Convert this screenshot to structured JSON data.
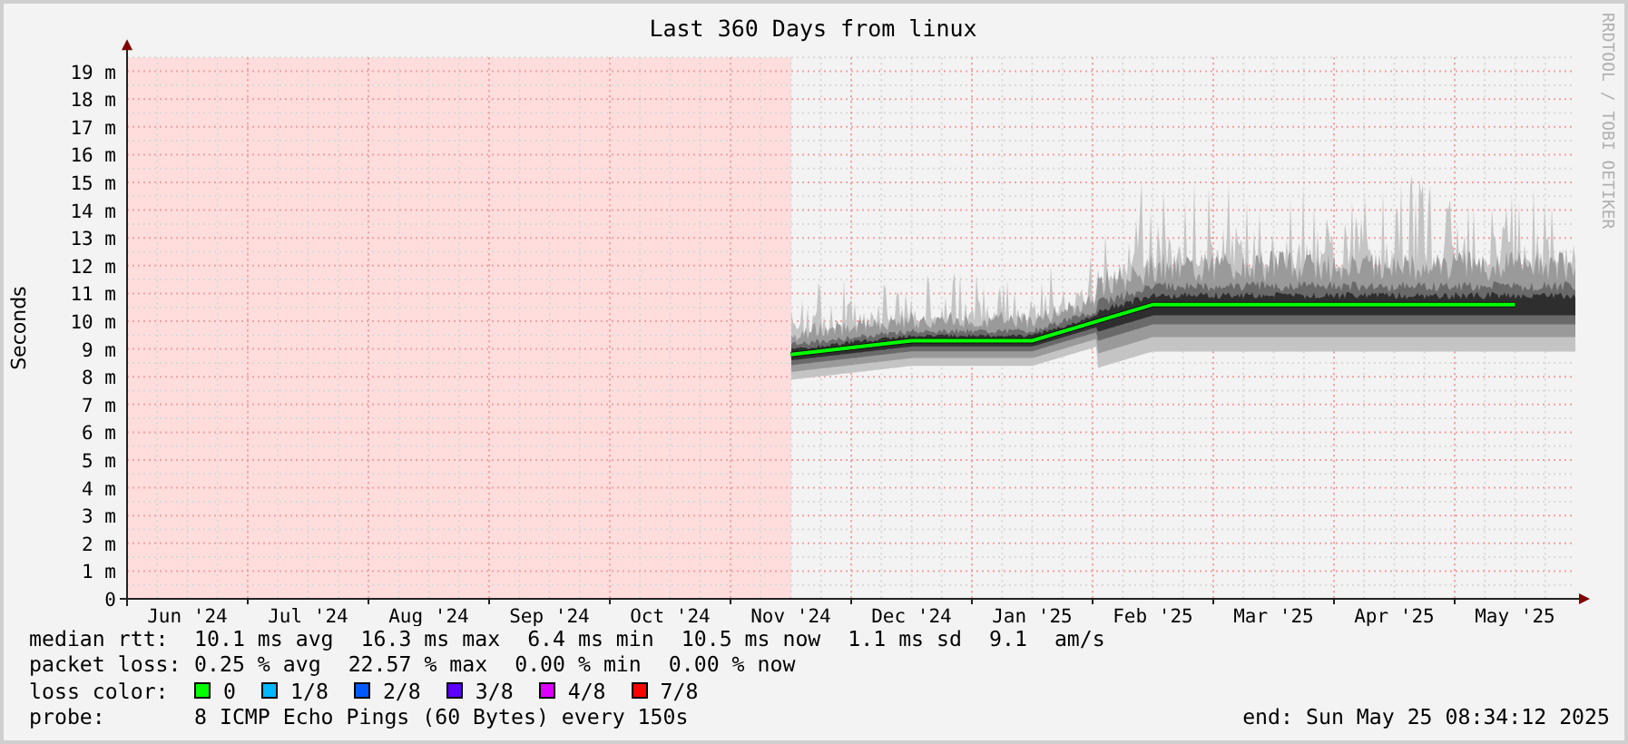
{
  "title": "Last 360 Days from linux",
  "credit": "RRDTOOL / TOBI OETIKER",
  "chart_data": {
    "type": "line",
    "grid": true,
    "ylabel": "Seconds",
    "ylim": [
      0,
      19.5
    ],
    "categories": [
      "Jun '24",
      "Jul '24",
      "Aug '24",
      "Sep '24",
      "Oct '24",
      "Nov '24",
      "Dec '24",
      "Jan '25",
      "Feb '25",
      "Mar '25",
      "Apr '25",
      "May '25"
    ],
    "yticks": [
      {
        "value": 0,
        "label": "0"
      },
      {
        "value": 1,
        "label": "1 m"
      },
      {
        "value": 2,
        "label": "2 m"
      },
      {
        "value": 3,
        "label": "3 m"
      },
      {
        "value": 4,
        "label": "4 m"
      },
      {
        "value": 5,
        "label": "5 m"
      },
      {
        "value": 6,
        "label": "6 m"
      },
      {
        "value": 7,
        "label": "7 m"
      },
      {
        "value": 8,
        "label": "8 m"
      },
      {
        "value": 9,
        "label": "9 m"
      },
      {
        "value": 10,
        "label": "10 m"
      },
      {
        "value": 11,
        "label": "11 m"
      },
      {
        "value": 12,
        "label": "12 m"
      },
      {
        "value": 13,
        "label": "13 m"
      },
      {
        "value": 14,
        "label": "14 m"
      },
      {
        "value": 15,
        "label": "15 m"
      },
      {
        "value": 16,
        "label": "16 m"
      },
      {
        "value": 17,
        "label": "17 m"
      },
      {
        "value": 18,
        "label": "18 m"
      },
      {
        "value": 19,
        "label": "19 m"
      }
    ],
    "series": [
      {
        "name": "median rtt:",
        "color": "#00ff00",
        "values": [
          null,
          null,
          null,
          null,
          null,
          8.8,
          9.3,
          9.3,
          10.6,
          10.6,
          10.6,
          10.6
        ]
      }
    ]
  },
  "legend": {
    "median_rtt": {
      "values": [
        "10.1 ms avg",
        "16.3 ms max",
        "6.4 ms min",
        "10.5 ms now",
        "1.1 ms sd",
        "9.1",
        "am/s"
      ]
    },
    "packet_loss": {
      "label": "packet loss:",
      "values": [
        "0.25 % avg",
        "22.57 % max",
        "0.00 % min",
        "0.00 % now"
      ]
    },
    "loss_color": {
      "label": "loss color:",
      "items": [
        {
          "label": "0",
          "color": "#00ff00"
        },
        {
          "label": "1/8",
          "color": "#00b8ff"
        },
        {
          "label": "2/8",
          "color": "#0059ff"
        },
        {
          "label": "3/8",
          "color": "#5e00ff"
        },
        {
          "label": "4/8",
          "color": "#dd00ff"
        },
        {
          "label": "7/8",
          "color": "#ff0000"
        }
      ]
    },
    "probe": {
      "label": "probe:",
      "value": "8 ICMP Echo Pings (60 Bytes) every 150s"
    },
    "end": "end: Sun May 25 08:34:12 2025"
  }
}
